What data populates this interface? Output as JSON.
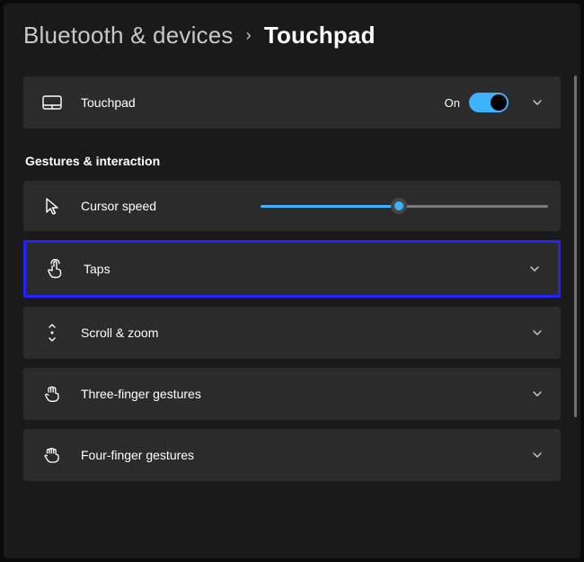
{
  "breadcrumb": {
    "parent": "Bluetooth & devices",
    "current": "Touchpad"
  },
  "touchpad_card": {
    "label": "Touchpad",
    "status": "On"
  },
  "section_label": "Gestures & interaction",
  "cursor_speed_card": {
    "label": "Cursor speed",
    "value_percent": 48
  },
  "taps_card": {
    "label": "Taps"
  },
  "scroll_zoom_card": {
    "label": "Scroll & zoom"
  },
  "three_finger_card": {
    "label": "Three-finger gestures"
  },
  "four_finger_card": {
    "label": "Four-finger gestures"
  },
  "colors": {
    "accent": "#3db2ff",
    "highlight": "#2323ff"
  }
}
